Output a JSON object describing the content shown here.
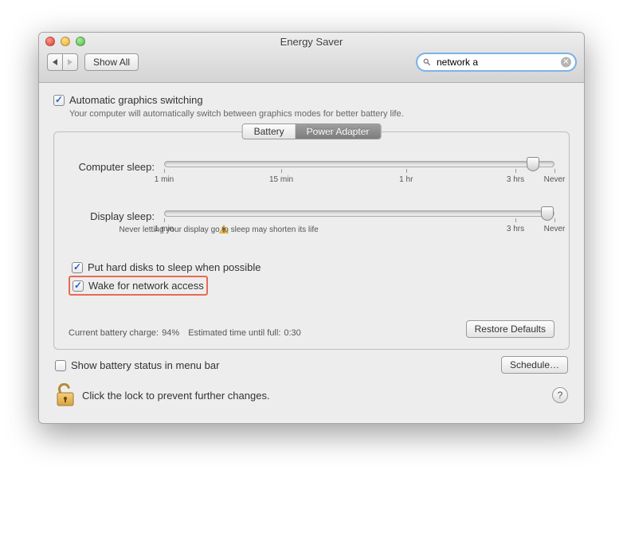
{
  "window": {
    "title": "Energy Saver"
  },
  "toolbar": {
    "show_all": "Show All",
    "search_value": "network a"
  },
  "auto_graphics": {
    "label": "Automatic graphics switching",
    "desc": "Your computer will automatically switch between graphics modes for better battery life."
  },
  "tabs": {
    "battery": "Battery",
    "power_adapter": "Power Adapter"
  },
  "computer_sleep": {
    "label": "Computer sleep:",
    "ticks": {
      "min1": "1 min",
      "min15": "15 min",
      "hr1": "1 hr",
      "hrs3": "3 hrs",
      "never": "Never"
    }
  },
  "display_sleep": {
    "label": "Display sleep:",
    "ticks": {
      "min1": "1 min",
      "hr3": "3 hrs",
      "never": "Never"
    },
    "warning": "Never letting your display go to sleep may shorten its life"
  },
  "hdd_sleep": "Put hard disks to sleep when possible",
  "wake_net": "Wake for network access",
  "battery_status": {
    "charge_label": "Current battery charge:",
    "charge_value": "94%",
    "eta_label": "Estimated time until full:",
    "eta_value": "0:30"
  },
  "restore_defaults": "Restore Defaults",
  "show_battery_menu": "Show battery status in menu bar",
  "schedule": "Schedule…",
  "lock_msg": "Click the lock to prevent further changes."
}
